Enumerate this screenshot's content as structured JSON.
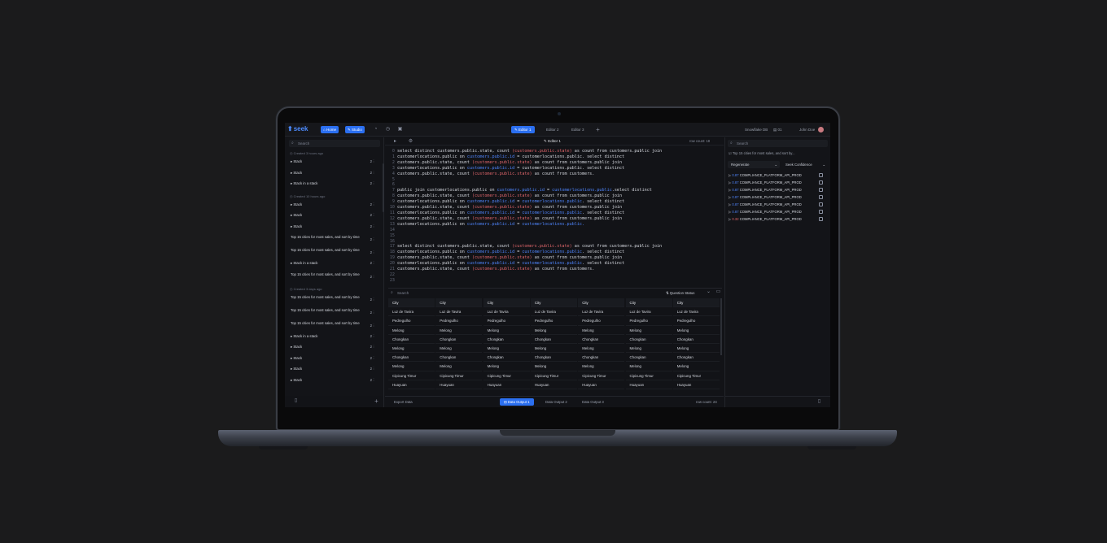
{
  "app": {
    "logo": "seek"
  },
  "nav": {
    "home": "Home",
    "studio": "Studio"
  },
  "editor_tabs": [
    "Editor 1",
    "Editor 2",
    "Editor 3"
  ],
  "top_right": {
    "db": "Snowflake DB",
    "count": "01",
    "user": "John Doe"
  },
  "sidebar": {
    "search_placeholder": "Search",
    "groups": [
      {
        "label": "Created 3 hours ago",
        "items": [
          {
            "label": "Stack",
            "count": "2"
          },
          {
            "label": "Stack",
            "count": "2"
          },
          {
            "label": "Stack in a stack",
            "count": "2"
          }
        ]
      },
      {
        "label": "Created 10 hours ago",
        "items": [
          {
            "label": "Stack",
            "count": "2"
          },
          {
            "label": "Stack",
            "count": "2"
          },
          {
            "label": "Stack",
            "count": "2"
          },
          {
            "label": "Top 15 cities for most sales, and sort by time",
            "count": "2"
          },
          {
            "label": "Top 15 cities for most sales, and sort by time",
            "count": "2"
          },
          {
            "label": "Stack in a stack",
            "count": "2"
          },
          {
            "label": "Top 15 cities for most sales, and sort by time",
            "count": "2"
          }
        ]
      },
      {
        "label": "Created 3 days ago",
        "items": [
          {
            "label": "Top 15 cities for most sales, and sort by time",
            "count": "2"
          },
          {
            "label": "Top 15 cities for most sales, and sort by time",
            "count": "2"
          },
          {
            "label": "Top 15 cities for most sales, and sort by time",
            "count": "2"
          },
          {
            "label": "Stack in a stack",
            "count": "2"
          },
          {
            "label": "Stack",
            "count": "2"
          },
          {
            "label": "Stack",
            "count": "2"
          },
          {
            "label": "Stack",
            "count": "2"
          },
          {
            "label": "Stack",
            "count": "2"
          }
        ]
      }
    ]
  },
  "editor": {
    "title": "Editor 1",
    "row_count": "row count: 18",
    "lines": [
      {
        "n": "0",
        "parts": [
          [
            "select distinct customers.public.state, count ",
            ""
          ],
          [
            "(customers.public.state)",
            "r"
          ],
          [
            " as count from customers.public join",
            ""
          ]
        ]
      },
      {
        "n": "1",
        "parts": [
          [
            "customerlocations.public on ",
            ""
          ],
          [
            "customers.public.id",
            "b"
          ],
          [
            " = ",
            ""
          ],
          [
            "customerlocations.public",
            ""
          ],
          [
            ". select distinct",
            ""
          ]
        ]
      },
      {
        "n": "2",
        "parts": [
          [
            "customers.public.state, count ",
            ""
          ],
          [
            "(customers.public.state)",
            "r"
          ],
          [
            " as count from customers.public join",
            ""
          ]
        ]
      },
      {
        "n": "3",
        "parts": [
          [
            "customerlocations.public on ",
            ""
          ],
          [
            "customers.public.id",
            "b"
          ],
          [
            " = ",
            ""
          ],
          [
            "customerlocations.public",
            ""
          ],
          [
            ". select distinct",
            ""
          ]
        ]
      },
      {
        "n": "4",
        "parts": [
          [
            "customers.public.state, count ",
            ""
          ],
          [
            "(customers.public.state)",
            "r"
          ],
          [
            " as count from customers.",
            ""
          ]
        ]
      },
      {
        "n": "5",
        "parts": []
      },
      {
        "n": "6",
        "parts": []
      },
      {
        "n": "7",
        "parts": [
          [
            "public join customerlocations.public on ",
            ""
          ],
          [
            "customers.public.id",
            "b"
          ],
          [
            " = ",
            ""
          ],
          [
            "customerlocations.public",
            "b"
          ],
          [
            ".select distinct",
            ""
          ]
        ]
      },
      {
        "n": "8",
        "parts": [
          [
            "customers.public.state, count ",
            ""
          ],
          [
            "(customers.public.state)",
            "r"
          ],
          [
            " as count from customers.public join",
            ""
          ]
        ]
      },
      {
        "n": "9",
        "parts": [
          [
            "customerlocations.public on ",
            ""
          ],
          [
            "customers.public.id",
            "b"
          ],
          [
            " = ",
            ""
          ],
          [
            "customerlocations.public",
            "b"
          ],
          [
            ". select distinct",
            ""
          ]
        ]
      },
      {
        "n": "10",
        "parts": [
          [
            "customers.public.state, count ",
            ""
          ],
          [
            "(customers.public.state)",
            "r"
          ],
          [
            " as count from customers.public join",
            ""
          ]
        ]
      },
      {
        "n": "11",
        "parts": [
          [
            "customerlocations.public on ",
            ""
          ],
          [
            "customers.public.id",
            "b"
          ],
          [
            " = ",
            ""
          ],
          [
            "customerlocations.public",
            "b"
          ],
          [
            ". select distinct",
            ""
          ]
        ]
      },
      {
        "n": "12",
        "parts": [
          [
            "customers.public.state, count ",
            ""
          ],
          [
            "(customers.public.state)",
            "r"
          ],
          [
            " as count from customers.public join",
            ""
          ]
        ]
      },
      {
        "n": "13",
        "parts": [
          [
            "customerlocations.public on ",
            ""
          ],
          [
            "customers.public.id",
            "b"
          ],
          [
            " = ",
            ""
          ],
          [
            "customerlocations.public.",
            "b"
          ]
        ]
      },
      {
        "n": "14",
        "parts": []
      },
      {
        "n": "15",
        "parts": []
      },
      {
        "n": "16",
        "parts": []
      },
      {
        "n": "17",
        "parts": [
          [
            "select distinct customers.public.state, count ",
            ""
          ],
          [
            "(customers.public.state)",
            "r"
          ],
          [
            " as count from customers.public join",
            ""
          ]
        ]
      },
      {
        "n": "18",
        "parts": [
          [
            "customerlocations.public on ",
            ""
          ],
          [
            "customers.public.id",
            "b"
          ],
          [
            " = ",
            ""
          ],
          [
            "customerlocations.public",
            "b"
          ],
          [
            ". select distinct",
            ""
          ]
        ]
      },
      {
        "n": "19",
        "parts": [
          [
            "customers.public.state, count ",
            ""
          ],
          [
            "(customers.public.state)",
            "r"
          ],
          [
            " as count from customers.public join",
            ""
          ]
        ]
      },
      {
        "n": "20",
        "parts": [
          [
            "customerlocations.public on ",
            ""
          ],
          [
            "customers.public.id",
            "b"
          ],
          [
            " = ",
            ""
          ],
          [
            "customerlocations.public",
            "b"
          ],
          [
            ". select distinct",
            ""
          ]
        ]
      },
      {
        "n": "21",
        "parts": [
          [
            "customers.public.state, count ",
            ""
          ],
          [
            "(customers.public.state)",
            "r"
          ],
          [
            " as count from customers.",
            ""
          ]
        ]
      },
      {
        "n": "22",
        "parts": []
      },
      {
        "n": "23",
        "parts": []
      }
    ]
  },
  "results": {
    "search_placeholder": "Search",
    "status_label": "Question Status",
    "column_header": "City",
    "column_count": 7,
    "rows": [
      "Luz de Tavira",
      "Pedregulho",
      "Melong",
      "Chongkan",
      "Melong",
      "Chongkan",
      "Melong",
      "Cipicung Timur",
      "Huayuan"
    ]
  },
  "bottom": {
    "export": "Export Data",
    "outputs": [
      "Data Output 1",
      "Data Output 2",
      "Data Output 3"
    ],
    "row_count": "row count: 24"
  },
  "right_panel": {
    "search_placeholder": "Search",
    "question": "Top 15 cities for most sales, and sort by...",
    "regenerate": "Regenerate",
    "confidence": "Seek Confidence",
    "items": [
      {
        "score": "0.87",
        "label": "COMPLIANCE_PLATFORM_API_PROD",
        "negative": false
      },
      {
        "score": "0.87",
        "label": "COMPLIANCE_PLATFORM_API_PROD",
        "negative": false
      },
      {
        "score": "0.87",
        "label": "COMPLIANCE_PLATFORM_API_PROD",
        "negative": false
      },
      {
        "score": "0.87",
        "label": "COMPLIANCE_PLATFORM_API_PROD",
        "negative": false
      },
      {
        "score": "0.87",
        "label": "COMPLIANCE_PLATFORM_API_PROD",
        "negative": false
      },
      {
        "score": "0.87",
        "label": "COMPLIANCE_PLATFORM_API_PROD",
        "negative": false
      },
      {
        "score": "0.32",
        "label": "COMPLIANCE_PLATFORM_API_PROD",
        "negative": true
      }
    ]
  },
  "colors": {
    "accent": "#2b6ff0",
    "link": "#4f86ff",
    "error": "#e0666b"
  }
}
